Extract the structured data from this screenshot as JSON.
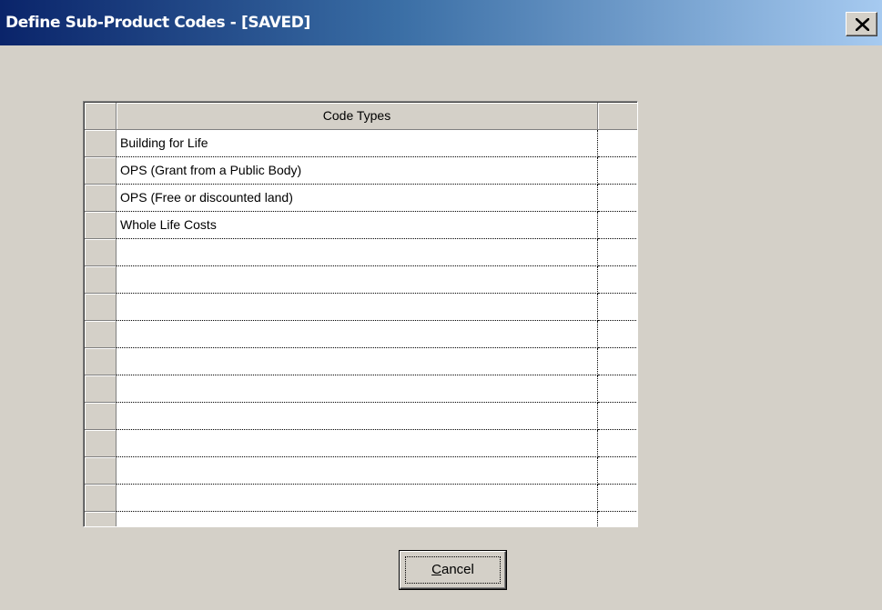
{
  "window": {
    "title": "Define Sub-Product Codes - [SAVED]",
    "close_icon": "close-icon"
  },
  "grid": {
    "column_header": "Code Types",
    "rows": [
      "Building for Life",
      "OPS (Grant from a Public Body)",
      "OPS (Free or discounted land)",
      "Whole Life Costs",
      "",
      "",
      "",
      "",
      "",
      "",
      "",
      "",
      "",
      "",
      ""
    ]
  },
  "buttons": {
    "cancel_label": "Cancel",
    "cancel_accelerator": "C",
    "cancel_rest": "ancel"
  },
  "colors": {
    "titlebar_start": "#0a246a",
    "titlebar_end": "#a6caf0",
    "face": "#d4d0c8"
  }
}
